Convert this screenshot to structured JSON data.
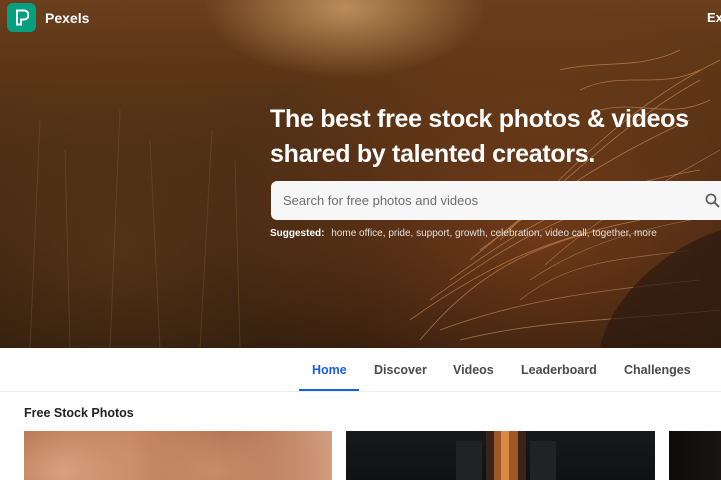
{
  "header": {
    "brand_name": "Pexels",
    "nav_partial": "Ex"
  },
  "hero": {
    "headline_line1": "The best free stock photos & videos",
    "headline_line2": "shared by talented creators.",
    "search": {
      "placeholder": "Search for free photos and videos"
    },
    "suggested_label": "Suggested:",
    "suggestions": [
      "home office,",
      "pride,",
      "support,",
      "growth,",
      "celebration,",
      "video call,",
      "together,",
      "more"
    ]
  },
  "tabs": [
    {
      "label": "Home",
      "active": true
    },
    {
      "label": "Discover",
      "active": false
    },
    {
      "label": "Videos",
      "active": false
    },
    {
      "label": "Leaderboard",
      "active": false
    },
    {
      "label": "Challenges",
      "active": false
    }
  ],
  "main": {
    "section_title": "Free Stock Photos"
  },
  "colors": {
    "brand": "#05a081",
    "active_tab": "#1a5ee0"
  },
  "icons": [
    "pexels-logo-icon",
    "search-icon"
  ]
}
